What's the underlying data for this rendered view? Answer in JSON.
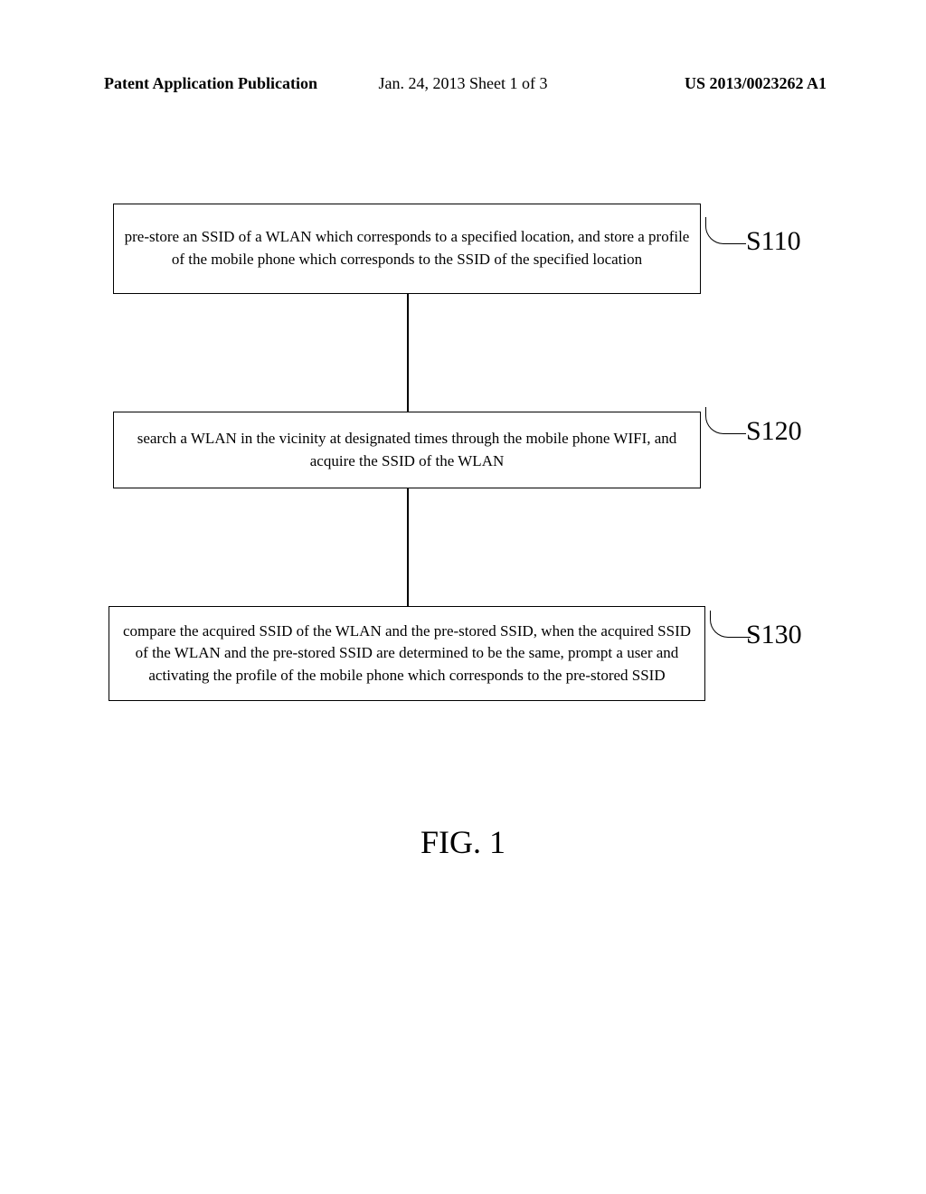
{
  "header": {
    "left": "Patent Application Publication",
    "center": "Jan. 24, 2013  Sheet 1 of 3",
    "right": "US 2013/0023262 A1"
  },
  "flowchart": {
    "box1": {
      "text": "pre-store an SSID of a WLAN which corresponds to a specified location, and store a profile of the mobile phone which corresponds to the SSID of the specified location",
      "label": "S110"
    },
    "box2": {
      "text": "search a WLAN in the vicinity at designated times through the mobile phone WIFI, and acquire the SSID of the WLAN",
      "label": "S120"
    },
    "box3": {
      "text": "compare the acquired SSID of the WLAN and the pre-stored SSID, when the acquired SSID of the WLAN and the pre-stored SSID are determined to be the same, prompt a user and activating the profile of the mobile phone which corresponds to the pre-stored SSID",
      "label": "S130"
    }
  },
  "figure_caption": "FIG. 1"
}
